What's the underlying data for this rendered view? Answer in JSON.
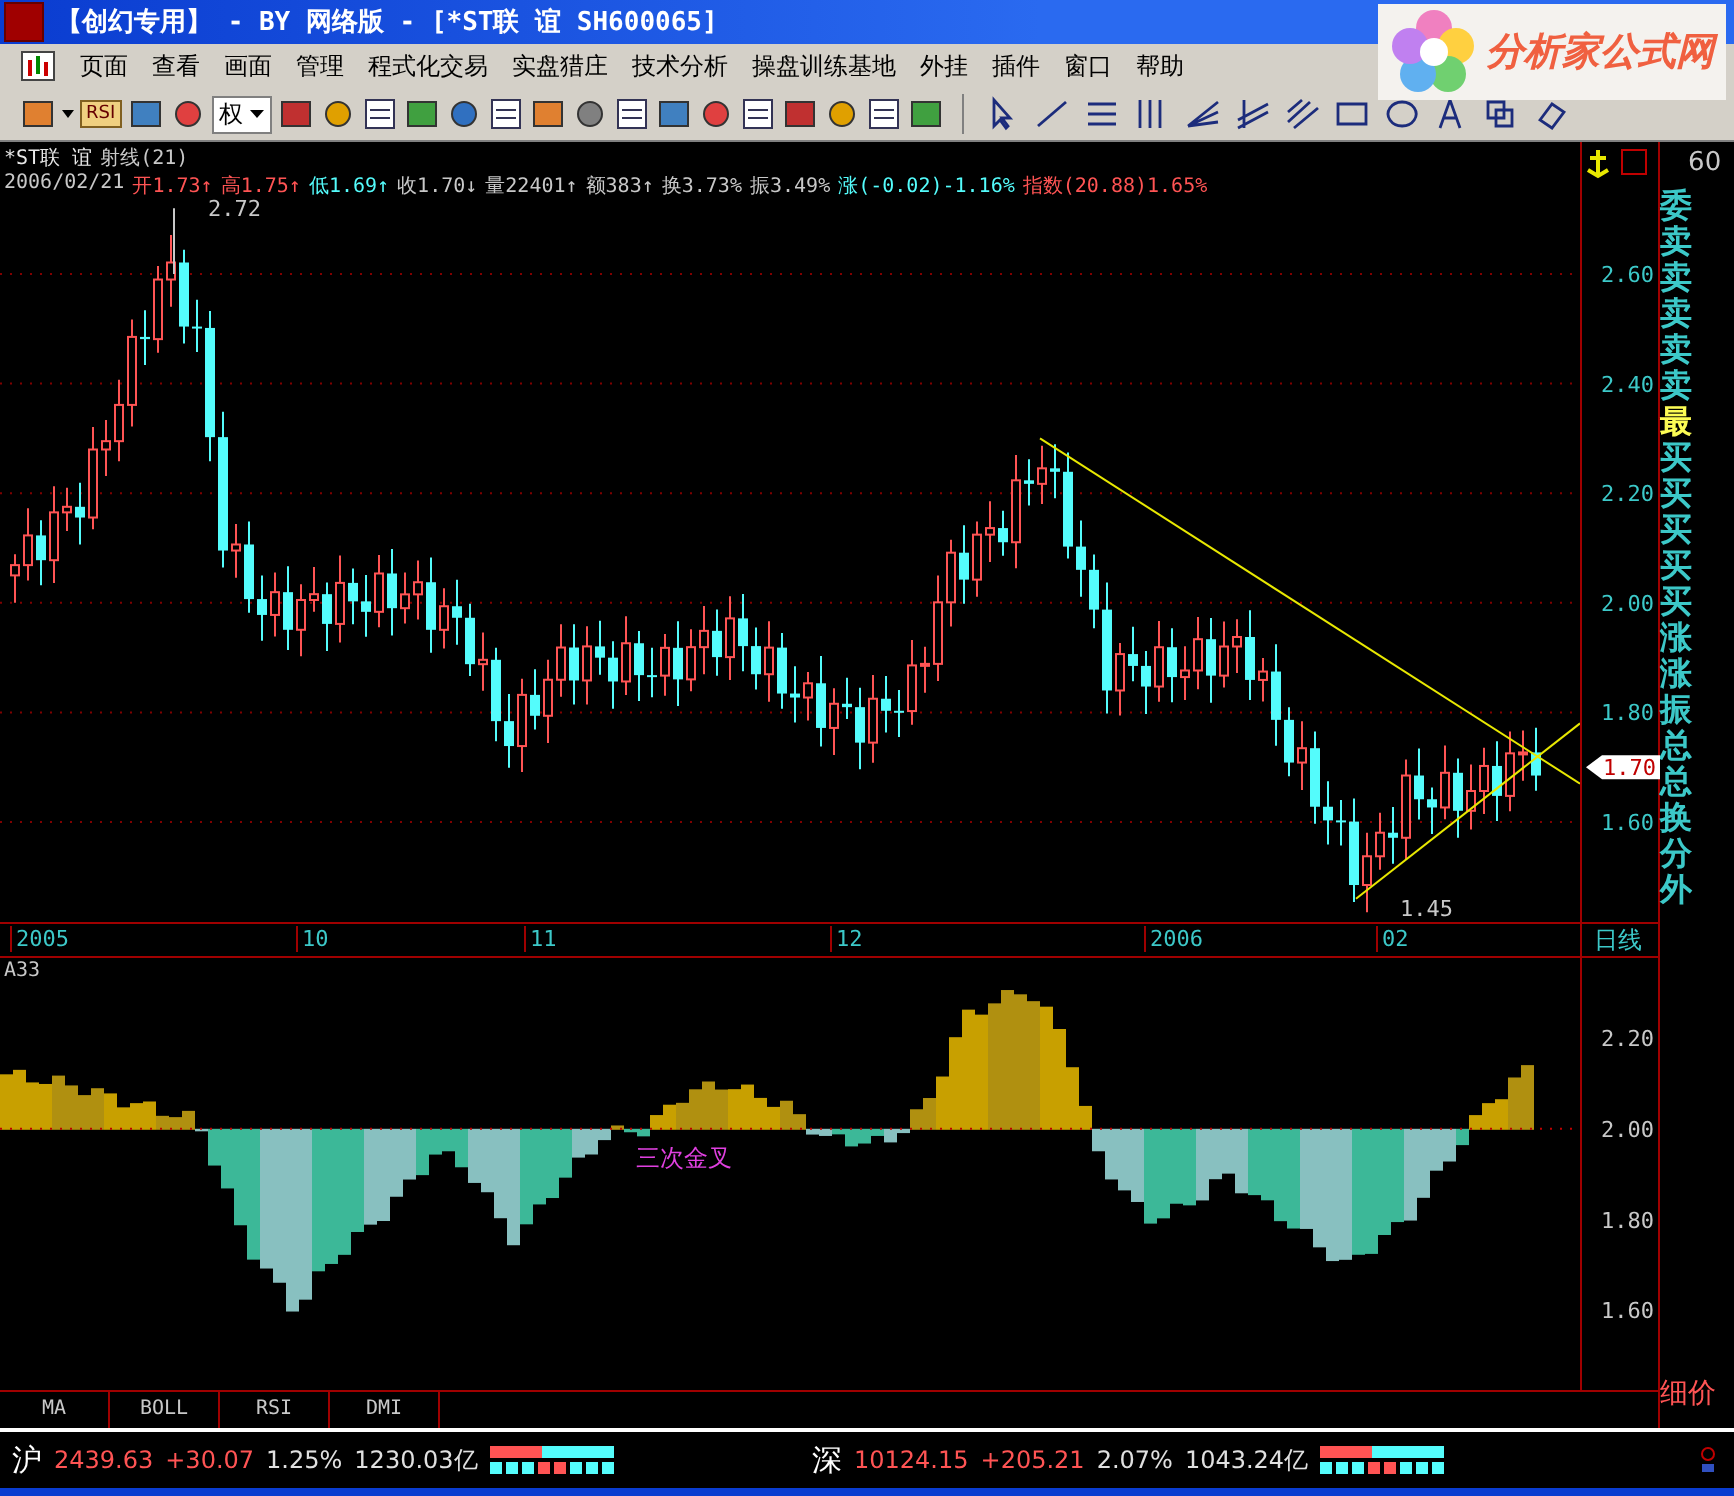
{
  "window": {
    "title": "【创幻专用】 - BY 网络版 - [*ST联 谊 SH600065]",
    "logo_text": "分析家公式网"
  },
  "menu": [
    "页面",
    "查看",
    "画面",
    "管理",
    "程式化交易",
    "实盘猎庄",
    "技术分析",
    "操盘训练基地",
    "外挂",
    "插件",
    "窗口",
    "帮助"
  ],
  "toolbar": {
    "indicator_label": "RSI",
    "rights_label": "权"
  },
  "chart": {
    "name": "*ST联 谊",
    "study": "射线(21)",
    "info": [
      {
        "text": "2006/02/21",
        "color": "#c8c8c8"
      },
      {
        "text": "开1.73↑",
        "color": "#ff5454"
      },
      {
        "text": "高1.75↑",
        "color": "#ff5454"
      },
      {
        "text": "低1.69↑",
        "color": "#54fcfc"
      },
      {
        "text": "收1.70↓",
        "color": "#c8c8c8"
      },
      {
        "text": "量22401↑",
        "color": "#c8c8c8"
      },
      {
        "text": "额383↑",
        "color": "#c8c8c8"
      },
      {
        "text": "换3.73%",
        "color": "#c8c8c8"
      },
      {
        "text": "振3.49%",
        "color": "#c8c8c8"
      },
      {
        "text": "涨(-0.02)-1.16%",
        "color": "#54fcfc"
      },
      {
        "text": "指数(20.88)1.65%",
        "color": "#ff5454"
      }
    ],
    "high_label": "2.72",
    "low_label": "1.45",
    "price_ticks": [
      "2.60",
      "2.40",
      "2.20",
      "2.00",
      "1.80",
      "1.60"
    ],
    "current_price": "1.70",
    "dates": [
      "2005",
      "10",
      "11",
      "12",
      "2006",
      "02"
    ],
    "period": "日线"
  },
  "indicator": {
    "name": "A33",
    "ticks": [
      "2.20",
      "2.00",
      "1.80",
      "1.60"
    ],
    "annotation": "三次金叉"
  },
  "tabs": [
    "MA",
    "BOLL",
    "RSI",
    "DMI"
  ],
  "quote_panel": {
    "header": "60",
    "rows": [
      {
        "text": "委",
        "color": "#3cc8c8"
      },
      {
        "text": "卖",
        "color": "#3cc8c8"
      },
      {
        "text": "卖",
        "color": "#3cc8c8"
      },
      {
        "text": "卖",
        "color": "#3cc8c8"
      },
      {
        "text": "卖",
        "color": "#3cc8c8"
      },
      {
        "text": "卖",
        "color": "#3cc8c8"
      },
      {
        "text": "最",
        "color": "#fcfc54"
      },
      {
        "text": "买",
        "color": "#3cc8c8"
      },
      {
        "text": "买",
        "color": "#3cc8c8"
      },
      {
        "text": "买",
        "color": "#3cc8c8"
      },
      {
        "text": "买",
        "color": "#3cc8c8"
      },
      {
        "text": "买",
        "color": "#3cc8c8"
      },
      {
        "text": "涨",
        "color": "#3cc8c8"
      },
      {
        "text": "涨",
        "color": "#3cc8c8"
      },
      {
        "text": "振",
        "color": "#3cc8c8"
      },
      {
        "text": "总",
        "color": "#3cc8c8"
      },
      {
        "text": "总",
        "color": "#3cc8c8"
      },
      {
        "text": "换",
        "color": "#3cc8c8"
      },
      {
        "text": "分",
        "color": "#3cc8c8"
      },
      {
        "text": "外",
        "color": "#3cc8c8"
      }
    ],
    "footer": "细价"
  },
  "status_bar": [
    {
      "market": "沪",
      "index": "2439.63",
      "change": "+30.07",
      "percent": "1.25%",
      "turnover": "1230.03亿"
    },
    {
      "market": "深",
      "index": "10124.15",
      "change": "+205.21",
      "percent": "2.07%",
      "turnover": "1043.24亿"
    }
  ]
}
